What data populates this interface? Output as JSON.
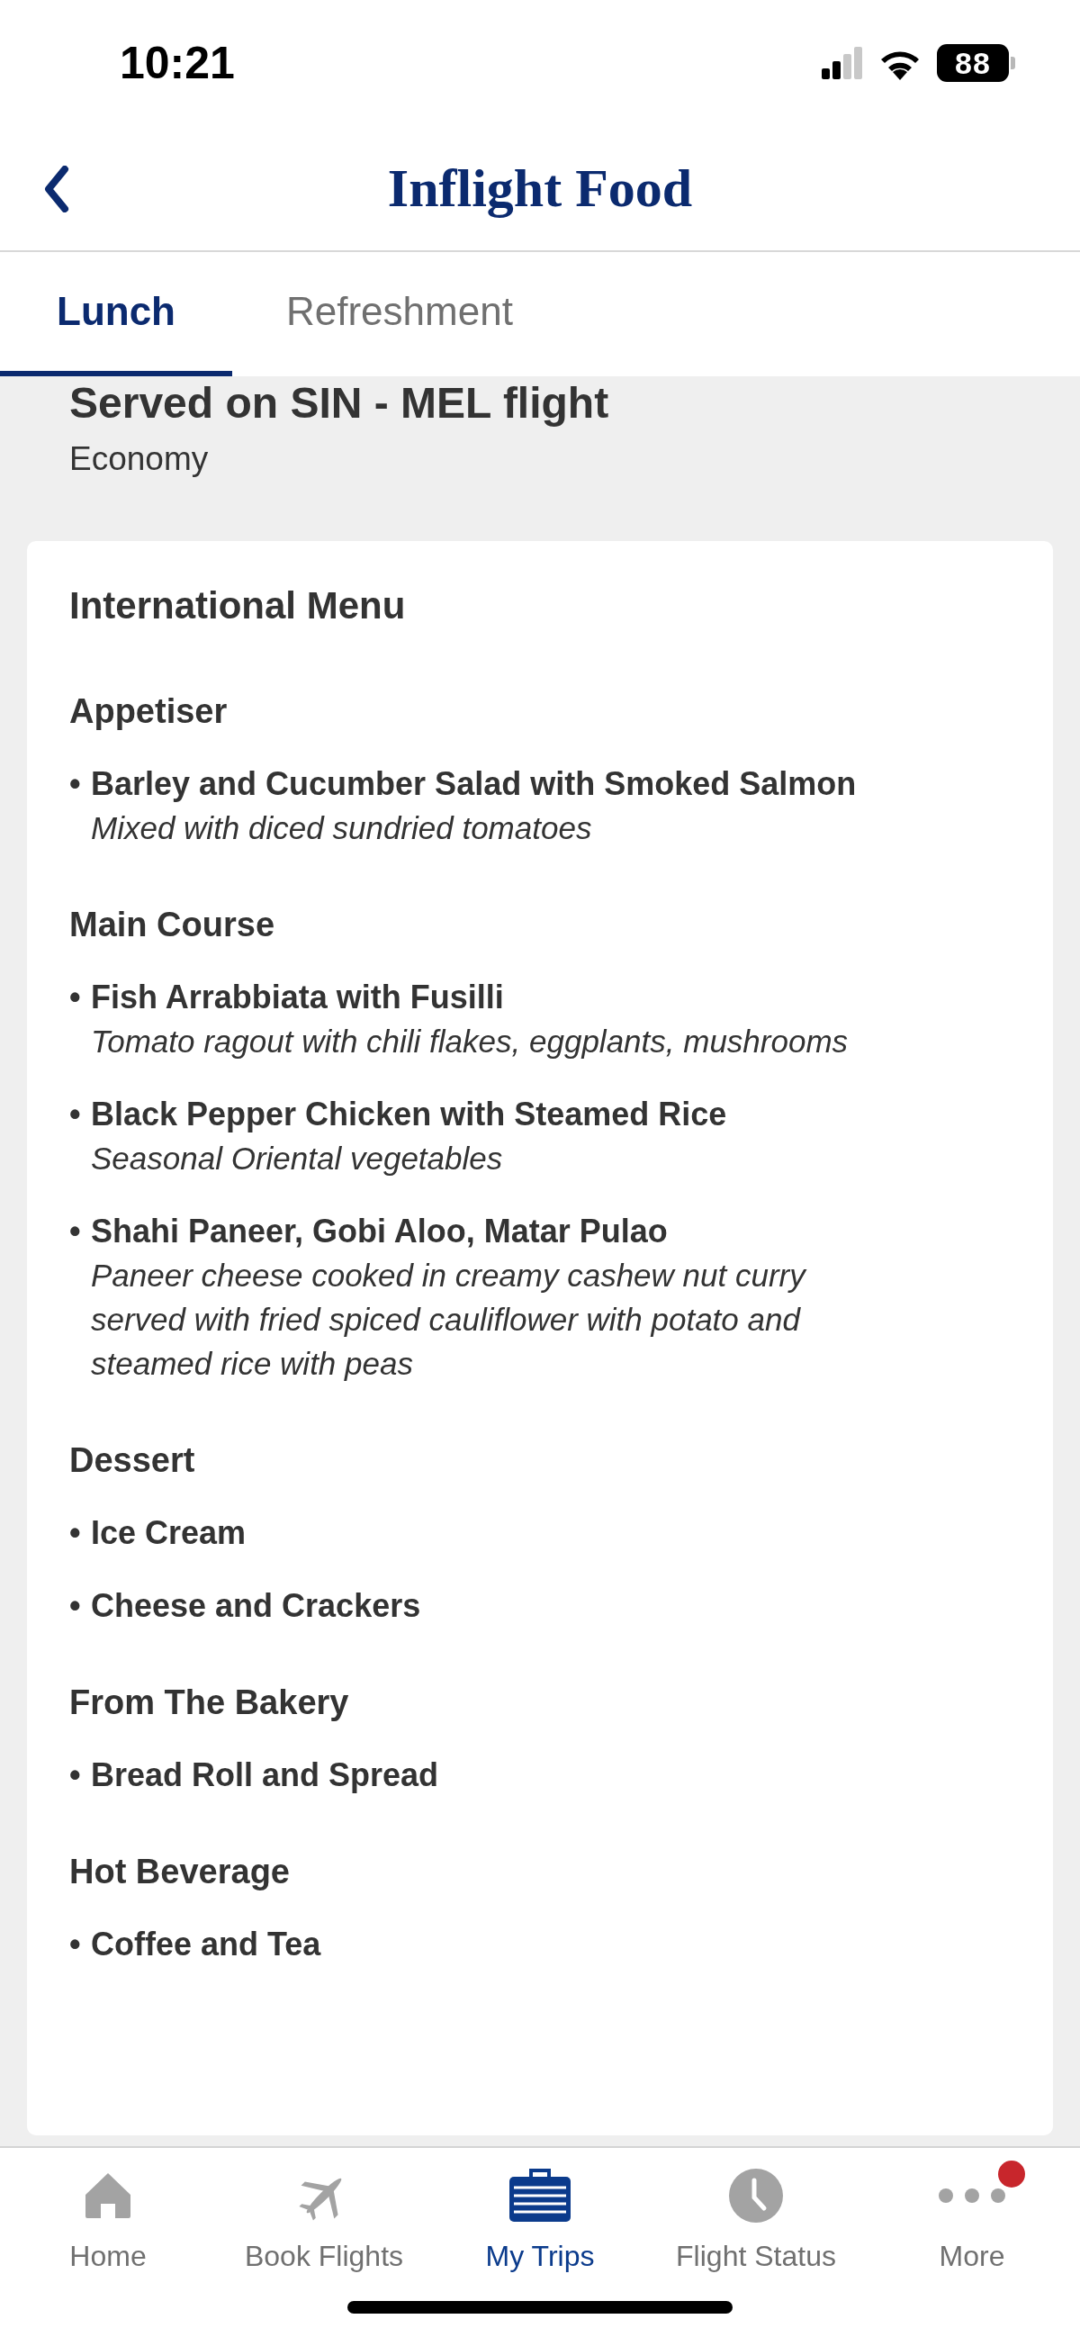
{
  "status_bar": {
    "time": "10:21",
    "battery": "88"
  },
  "header": {
    "title": "Inflight Food"
  },
  "tabs": [
    {
      "label": "Lunch",
      "selected": true
    },
    {
      "label": "Refreshment",
      "selected": false
    }
  ],
  "flight": {
    "title": "Served on SIN - MEL flight",
    "cabin": "Economy"
  },
  "menu": {
    "title": "International Menu",
    "sections": [
      {
        "heading": "Appetiser",
        "items": [
          {
            "bullet": "•",
            "name": "Barley and Cucumber Salad with Smoked Salmon",
            "description": "Mixed with diced sundried tomatoes"
          }
        ]
      },
      {
        "heading": "Main Course",
        "items": [
          {
            "bullet": "•",
            "name": "Fish Arrabbiata with Fusilli",
            "description": "Tomato ragout with chili flakes, eggplants, mushrooms"
          },
          {
            "bullet": "•",
            "name": "Black Pepper Chicken with Steamed Rice",
            "description": "Seasonal Oriental vegetables"
          },
          {
            "bullet": "•",
            "name": "Shahi Paneer, Gobi Aloo, Matar Pulao",
            "description": "Paneer cheese cooked in creamy cashew nut curry served with fried spiced cauliflower with potato and steamed rice with peas"
          }
        ]
      },
      {
        "heading": "Dessert",
        "items": [
          {
            "bullet": "•",
            "name": "Ice Cream"
          },
          {
            "bullet": "•",
            "name": "Cheese and Crackers"
          }
        ]
      },
      {
        "heading": "From The Bakery",
        "items": [
          {
            "bullet": "•",
            "name": "Bread Roll and Spread"
          }
        ]
      },
      {
        "heading": "Hot Beverage",
        "items": [
          {
            "bullet": "•",
            "name": "Coffee and Tea"
          }
        ]
      }
    ]
  },
  "bottom_nav": [
    {
      "kind": "home",
      "label": "Home",
      "selected": false
    },
    {
      "kind": "plane",
      "label": "Book Flights",
      "selected": false
    },
    {
      "kind": "trips",
      "label": "My Trips",
      "selected": true
    },
    {
      "kind": "status",
      "label": "Flight Status",
      "selected": false
    },
    {
      "kind": "more",
      "label": "More",
      "selected": false,
      "color": "#c8262c"
    }
  ]
}
